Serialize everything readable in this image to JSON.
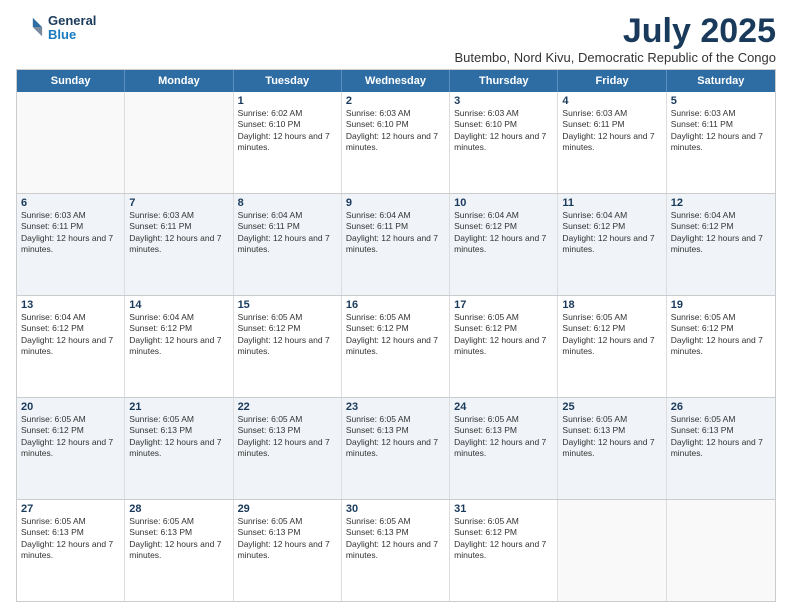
{
  "logo": {
    "line1": "General",
    "line2": "Blue"
  },
  "title": "July 2025",
  "subtitle": "Butembo, Nord Kivu, Democratic Republic of the Congo",
  "days": [
    "Sunday",
    "Monday",
    "Tuesday",
    "Wednesday",
    "Thursday",
    "Friday",
    "Saturday"
  ],
  "weeks": [
    [
      {
        "num": "",
        "text": "",
        "empty": true
      },
      {
        "num": "",
        "text": "",
        "empty": true
      },
      {
        "num": "1",
        "text": "Sunrise: 6:02 AM\nSunset: 6:10 PM\nDaylight: 12 hours and 7 minutes."
      },
      {
        "num": "2",
        "text": "Sunrise: 6:03 AM\nSunset: 6:10 PM\nDaylight: 12 hours and 7 minutes."
      },
      {
        "num": "3",
        "text": "Sunrise: 6:03 AM\nSunset: 6:10 PM\nDaylight: 12 hours and 7 minutes."
      },
      {
        "num": "4",
        "text": "Sunrise: 6:03 AM\nSunset: 6:11 PM\nDaylight: 12 hours and 7 minutes."
      },
      {
        "num": "5",
        "text": "Sunrise: 6:03 AM\nSunset: 6:11 PM\nDaylight: 12 hours and 7 minutes."
      }
    ],
    [
      {
        "num": "6",
        "text": "Sunrise: 6:03 AM\nSunset: 6:11 PM\nDaylight: 12 hours and 7 minutes."
      },
      {
        "num": "7",
        "text": "Sunrise: 6:03 AM\nSunset: 6:11 PM\nDaylight: 12 hours and 7 minutes."
      },
      {
        "num": "8",
        "text": "Sunrise: 6:04 AM\nSunset: 6:11 PM\nDaylight: 12 hours and 7 minutes."
      },
      {
        "num": "9",
        "text": "Sunrise: 6:04 AM\nSunset: 6:11 PM\nDaylight: 12 hours and 7 minutes."
      },
      {
        "num": "10",
        "text": "Sunrise: 6:04 AM\nSunset: 6:12 PM\nDaylight: 12 hours and 7 minutes."
      },
      {
        "num": "11",
        "text": "Sunrise: 6:04 AM\nSunset: 6:12 PM\nDaylight: 12 hours and 7 minutes."
      },
      {
        "num": "12",
        "text": "Sunrise: 6:04 AM\nSunset: 6:12 PM\nDaylight: 12 hours and 7 minutes."
      }
    ],
    [
      {
        "num": "13",
        "text": "Sunrise: 6:04 AM\nSunset: 6:12 PM\nDaylight: 12 hours and 7 minutes."
      },
      {
        "num": "14",
        "text": "Sunrise: 6:04 AM\nSunset: 6:12 PM\nDaylight: 12 hours and 7 minutes."
      },
      {
        "num": "15",
        "text": "Sunrise: 6:05 AM\nSunset: 6:12 PM\nDaylight: 12 hours and 7 minutes."
      },
      {
        "num": "16",
        "text": "Sunrise: 6:05 AM\nSunset: 6:12 PM\nDaylight: 12 hours and 7 minutes."
      },
      {
        "num": "17",
        "text": "Sunrise: 6:05 AM\nSunset: 6:12 PM\nDaylight: 12 hours and 7 minutes."
      },
      {
        "num": "18",
        "text": "Sunrise: 6:05 AM\nSunset: 6:12 PM\nDaylight: 12 hours and 7 minutes."
      },
      {
        "num": "19",
        "text": "Sunrise: 6:05 AM\nSunset: 6:12 PM\nDaylight: 12 hours and 7 minutes."
      }
    ],
    [
      {
        "num": "20",
        "text": "Sunrise: 6:05 AM\nSunset: 6:12 PM\nDaylight: 12 hours and 7 minutes."
      },
      {
        "num": "21",
        "text": "Sunrise: 6:05 AM\nSunset: 6:13 PM\nDaylight: 12 hours and 7 minutes."
      },
      {
        "num": "22",
        "text": "Sunrise: 6:05 AM\nSunset: 6:13 PM\nDaylight: 12 hours and 7 minutes."
      },
      {
        "num": "23",
        "text": "Sunrise: 6:05 AM\nSunset: 6:13 PM\nDaylight: 12 hours and 7 minutes."
      },
      {
        "num": "24",
        "text": "Sunrise: 6:05 AM\nSunset: 6:13 PM\nDaylight: 12 hours and 7 minutes."
      },
      {
        "num": "25",
        "text": "Sunrise: 6:05 AM\nSunset: 6:13 PM\nDaylight: 12 hours and 7 minutes."
      },
      {
        "num": "26",
        "text": "Sunrise: 6:05 AM\nSunset: 6:13 PM\nDaylight: 12 hours and 7 minutes."
      }
    ],
    [
      {
        "num": "27",
        "text": "Sunrise: 6:05 AM\nSunset: 6:13 PM\nDaylight: 12 hours and 7 minutes."
      },
      {
        "num": "28",
        "text": "Sunrise: 6:05 AM\nSunset: 6:13 PM\nDaylight: 12 hours and 7 minutes."
      },
      {
        "num": "29",
        "text": "Sunrise: 6:05 AM\nSunset: 6:13 PM\nDaylight: 12 hours and 7 minutes."
      },
      {
        "num": "30",
        "text": "Sunrise: 6:05 AM\nSunset: 6:13 PM\nDaylight: 12 hours and 7 minutes."
      },
      {
        "num": "31",
        "text": "Sunrise: 6:05 AM\nSunset: 6:12 PM\nDaylight: 12 hours and 7 minutes."
      },
      {
        "num": "",
        "text": "",
        "empty": true
      },
      {
        "num": "",
        "text": "",
        "empty": true
      }
    ]
  ]
}
